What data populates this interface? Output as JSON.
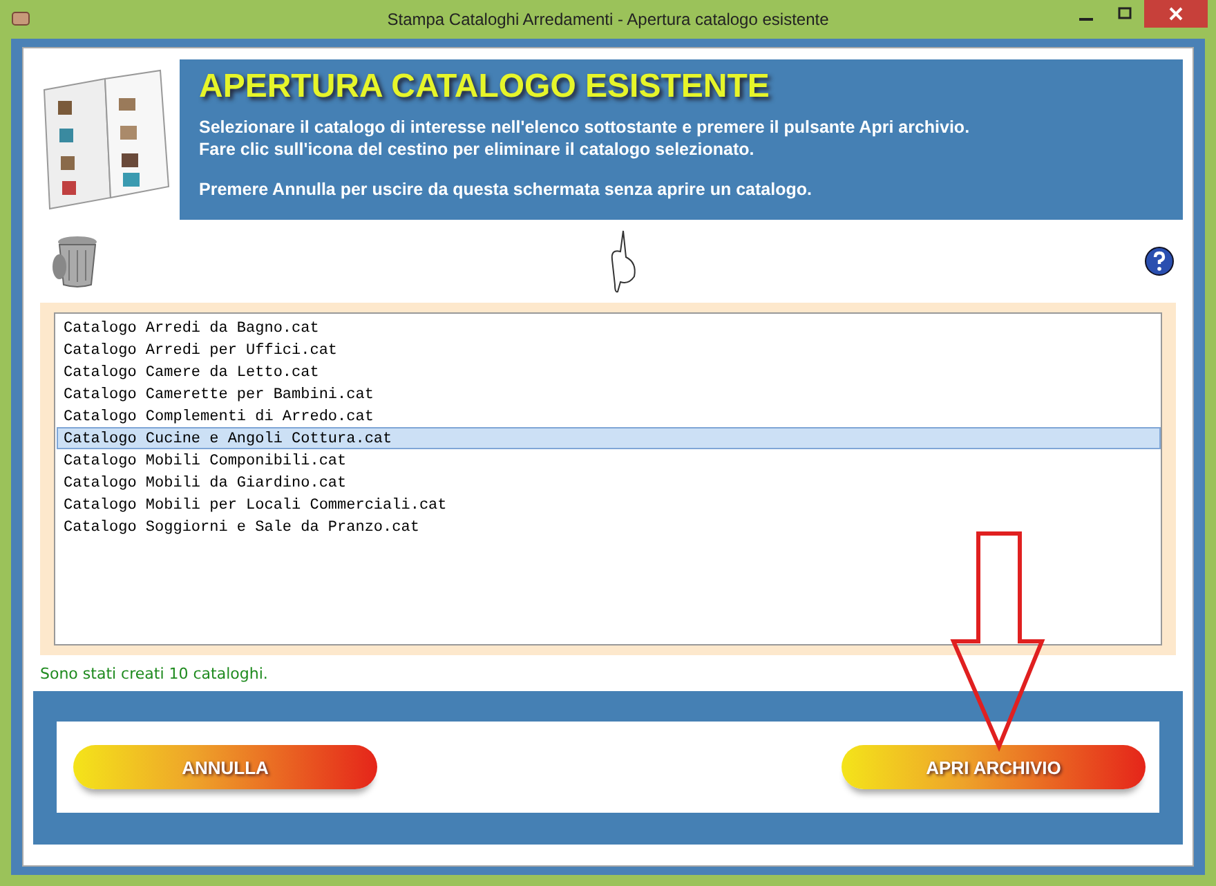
{
  "window": {
    "title": "Stampa Cataloghi Arredamenti - Apertura catalogo esistente"
  },
  "header": {
    "title": "APERTURA CATALOGO ESISTENTE",
    "lines": [
      "Selezionare il catalogo di interesse nell'elenco sottostante e premere il pulsante Apri archivio.",
      "Fare clic sull'icona del cestino per eliminare il catalogo selezionato.",
      "Premere Annulla per uscire da questa schermata senza aprire un catalogo."
    ]
  },
  "catalogs": [
    {
      "name": "Catalogo Arredi da Bagno.cat",
      "selected": false
    },
    {
      "name": "Catalogo Arredi per Uffici.cat",
      "selected": false
    },
    {
      "name": "Catalogo Camere da Letto.cat",
      "selected": false
    },
    {
      "name": "Catalogo Camerette per Bambini.cat",
      "selected": false
    },
    {
      "name": "Catalogo Complementi di Arredo.cat",
      "selected": false
    },
    {
      "name": "Catalogo Cucine e Angoli Cottura.cat",
      "selected": true
    },
    {
      "name": "Catalogo Mobili Componibili.cat",
      "selected": false
    },
    {
      "name": "Catalogo Mobili da Giardino.cat",
      "selected": false
    },
    {
      "name": "Catalogo Mobili per Locali Commerciali.cat",
      "selected": false
    },
    {
      "name": "Catalogo Soggiorni e Sale da Pranzo.cat",
      "selected": false
    }
  ],
  "status": "Sono stati creati 10 cataloghi.",
  "buttons": [
    "ANNULLA",
    "APRI ARCHIVIO"
  ]
}
